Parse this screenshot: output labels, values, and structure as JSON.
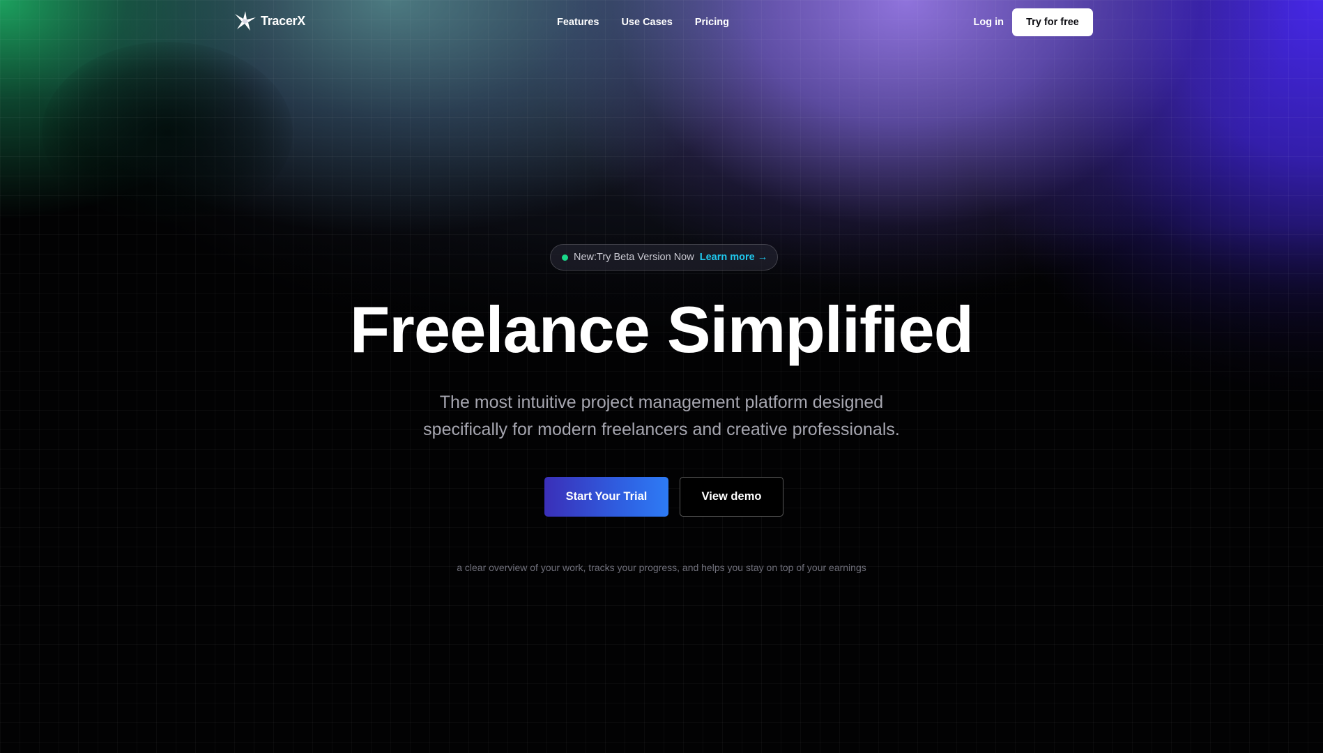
{
  "brand": {
    "name": "TracerX",
    "logo_icon": "star-burst-logo-icon"
  },
  "nav": {
    "links": [
      {
        "label": "Features"
      },
      {
        "label": "Use Cases"
      },
      {
        "label": "Pricing"
      }
    ],
    "login_label": "Log in",
    "cta_label": "Try for free"
  },
  "hero": {
    "badge": {
      "text": "New:Try Beta Version Now",
      "link_label": "Learn more →",
      "dot_color": "#1ad98a",
      "link_color": "#1fc8ee"
    },
    "headline": "Freelance Simplified",
    "subhead_line1": "The most intuitive project management platform designed",
    "subhead_line2": "specifically for modern freelancers and creative professionals.",
    "primary_cta": "Start Your Trial",
    "secondary_cta": "View demo",
    "tagline": "a clear overview of your work, tracks your progress, and helps you stay on top of your earnings"
  },
  "colors": {
    "background": "#020203",
    "glow_green": "#1eaa64",
    "glow_purple": "#9678e6",
    "glow_indigo": "#4628e6",
    "primary_gradient_start": "#3a2fb8",
    "primary_gradient_end": "#2d7bf5"
  }
}
